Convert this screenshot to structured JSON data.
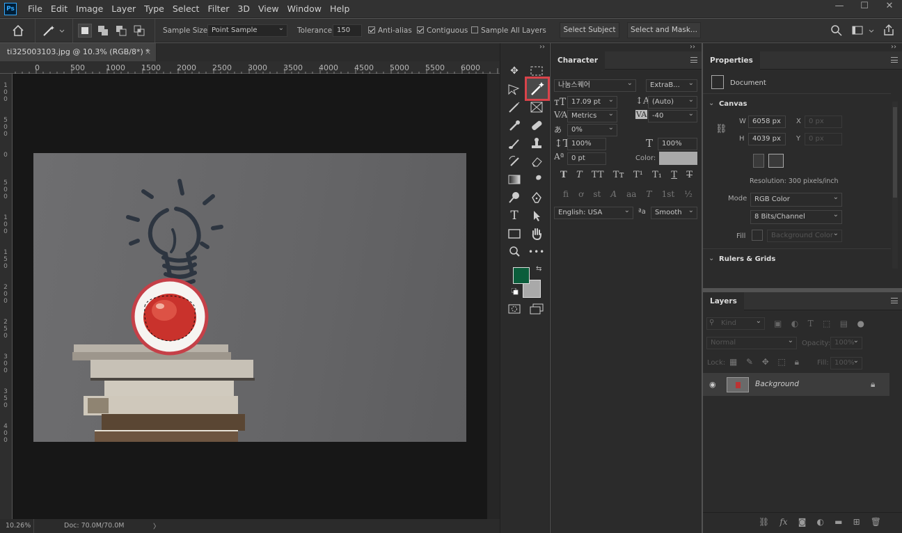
{
  "menubar": {
    "app_icon": "Ps",
    "items": [
      "File",
      "Edit",
      "Image",
      "Layer",
      "Type",
      "Select",
      "Filter",
      "3D",
      "View",
      "Window",
      "Help"
    ]
  },
  "options": {
    "sample_size_label": "Sample Size:",
    "sample_size_value": "Point Sample",
    "tolerance_label": "Tolerance:",
    "tolerance_value": "150",
    "anti_alias": "Anti-alias",
    "contiguous": "Contiguous",
    "sample_all_layers": "Sample All Layers",
    "select_subject": "Select Subject",
    "select_and_mask": "Select and Mask..."
  },
  "document": {
    "tab_title": "ti325003103.jpg @ 10.3% (RGB/8*) *",
    "close": "×"
  },
  "ruler": {
    "top_ticks": [
      "0",
      "500",
      "1000",
      "1500",
      "2000",
      "2500",
      "3000",
      "3500",
      "4000",
      "4500",
      "5000",
      "5500",
      "6000"
    ],
    "left_ticks": [
      "1",
      "0",
      "0",
      "5",
      "0",
      "0",
      "0",
      "5",
      "0",
      "0",
      "1",
      "0",
      "0",
      "1",
      "5",
      "0",
      "2",
      "0",
      "0",
      "2",
      "5",
      "0",
      "3",
      "0",
      "0",
      "3",
      "5",
      "0",
      "4",
      "0",
      "0"
    ]
  },
  "status": {
    "zoom": "10.26%",
    "doc": "Doc: 70.0M/70.0M",
    "arrow": "〉"
  },
  "colors": {
    "foreground": "#0b5d3b",
    "background": "#a9a9a9",
    "highlight": "#d9434a"
  },
  "character": {
    "title": "Character",
    "font": "나눔스퀘어",
    "style": "ExtraB...",
    "size": "17.09 pt",
    "leading": "(Auto)",
    "kerning": "Metrics",
    "tracking": "-40",
    "tsume": "0%",
    "vscale": "100%",
    "hscale": "100%",
    "baseline": "0 pt",
    "color_label": "Color:",
    "language": "English: USA",
    "antialias": "Smooth",
    "aa_label": "ªa"
  },
  "properties": {
    "title": "Properties",
    "doc_label": "Document",
    "canvas": "Canvas",
    "w_label": "W",
    "w_value": "6058 px",
    "x_label": "X",
    "x_placeholder": "0 px",
    "h_label": "H",
    "h_value": "4039 px",
    "y_label": "Y",
    "y_placeholder": "0 px",
    "resolution": "Resolution: 300 pixels/inch",
    "mode_label": "Mode",
    "mode_value": "RGB Color",
    "bits_value": "8 Bits/Channel",
    "fill_label": "Fill",
    "fill_value": "Background Color",
    "rulers": "Rulers & Grids"
  },
  "layers": {
    "title": "Layers",
    "kind": "Kind",
    "blend": "Normal",
    "opacity_label": "Opacity:",
    "opacity": "100%",
    "lock_label": "Lock:",
    "fill_label": "Fill:",
    "fill": "100%",
    "layer_name": "Background"
  }
}
